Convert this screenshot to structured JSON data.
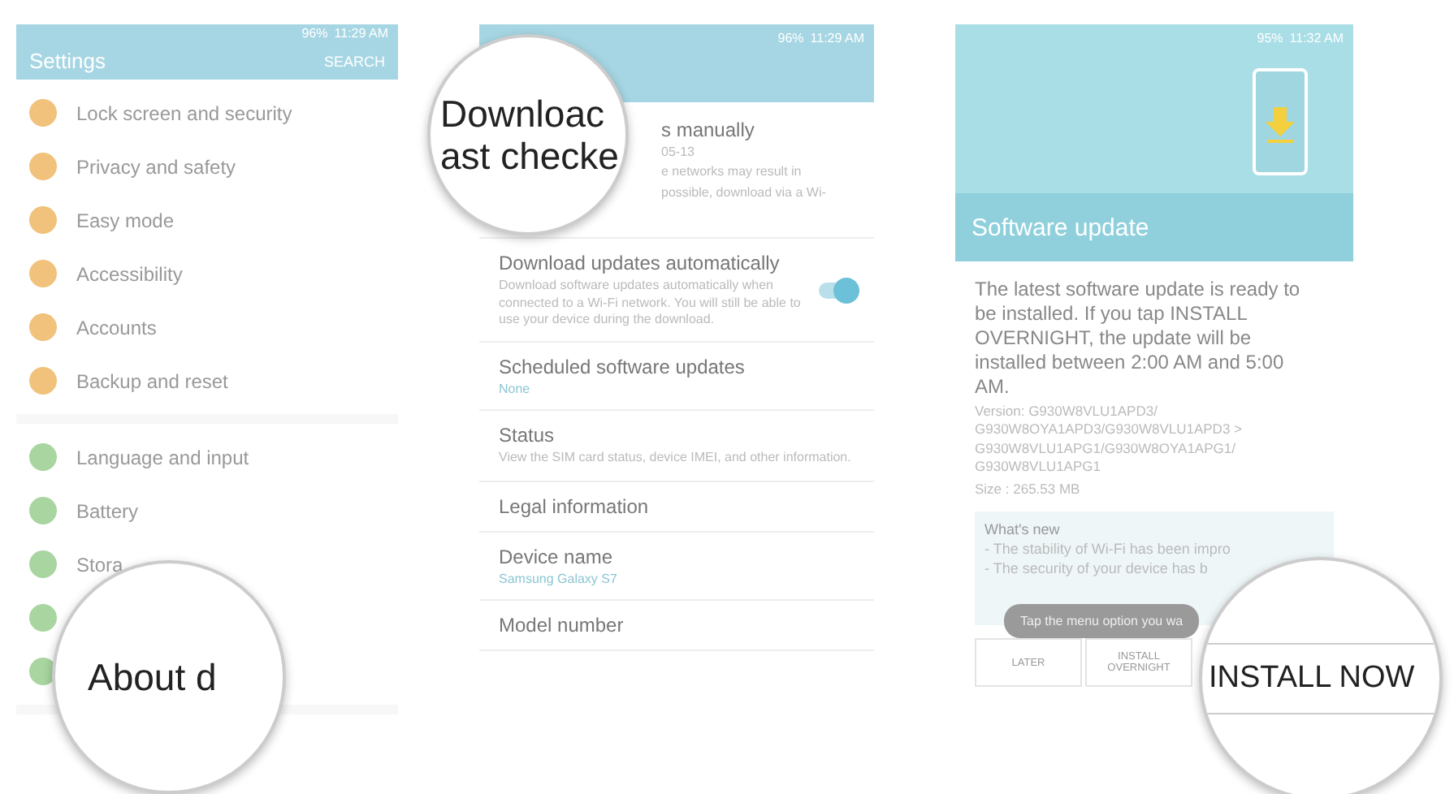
{
  "settings_screen": {
    "status_bar": {
      "battery": "96%",
      "time": "11:29 AM"
    },
    "title": "Settings",
    "search_action": "SEARCH",
    "groups": [
      {
        "items": [
          {
            "label": "Lock screen and security",
            "color": "#f0c27b"
          },
          {
            "label": "Privacy and safety",
            "color": "#f0c27b"
          },
          {
            "label": "Easy mode",
            "color": "#f0c27b"
          },
          {
            "label": "Accessibility",
            "color": "#f0c27b"
          },
          {
            "label": "Accounts",
            "color": "#f0c27b"
          },
          {
            "label": "Backup and reset",
            "color": "#f0c27b"
          }
        ]
      },
      {
        "items": [
          {
            "label": "Language and input",
            "color": "#a8d5a0"
          },
          {
            "label": "Battery",
            "color": "#a8d5a0"
          },
          {
            "label": "Stora",
            "color": "#a8d5a0"
          },
          {
            "color": "#a8d5a0"
          },
          {
            "color": "#a8d5a0"
          }
        ]
      }
    ],
    "magnifier": {
      "text": "About d"
    }
  },
  "about_screen": {
    "status_bar": {
      "battery": "96%",
      "time": "11:29 AM"
    },
    "rows": [
      {
        "kind": "partial",
        "title": "s manually",
        "lines": [
          "05-13",
          "e networks may result in",
          "possible, download via a Wi-"
        ]
      },
      {
        "kind": "toggle",
        "title": "Download updates automatically",
        "subtitle": "Download software updates automatically when connected to a Wi-Fi network. You will still be able to use your device during the download.",
        "on": true
      },
      {
        "kind": "value",
        "title": "Scheduled software updates",
        "value": "None"
      },
      {
        "kind": "text",
        "title": "Status",
        "subtitle": "View the SIM card status, device IMEI, and other information."
      },
      {
        "kind": "plain",
        "title": "Legal information"
      },
      {
        "kind": "value",
        "title": "Device name",
        "value": "Samsung Galaxy S7"
      },
      {
        "kind": "plain",
        "title": "Model number"
      }
    ],
    "magnifier": {
      "lines": [
        "Downloac",
        "ast checke"
      ]
    }
  },
  "update_screen": {
    "status_bar": {
      "battery": "95%",
      "time": "11:32 AM"
    },
    "title": "Software update",
    "message": "The latest software update is ready to be installed. If you tap INSTALL OVERNIGHT, the update will be installed between 2:00 AM and 5:00 AM.",
    "version": "Version: G930W8VLU1APD3/ G930W8OYA1APD3/G930W8VLU1APD3 > G930W8VLU1APG1/G930W8OYA1APG1/ G930W8VLU1APG1",
    "size": "Size : 265.53 MB",
    "whats_new": {
      "title": "What's new",
      "lines": [
        "- The stability of Wi-Fi has been impro",
        "- The security of your device has b"
      ]
    },
    "toast": "Tap the menu option you wa",
    "buttons": [
      "LATER",
      "INSTALL OVERNIGHT"
    ],
    "magnifier": {
      "text": "INSTALL NOW"
    }
  }
}
